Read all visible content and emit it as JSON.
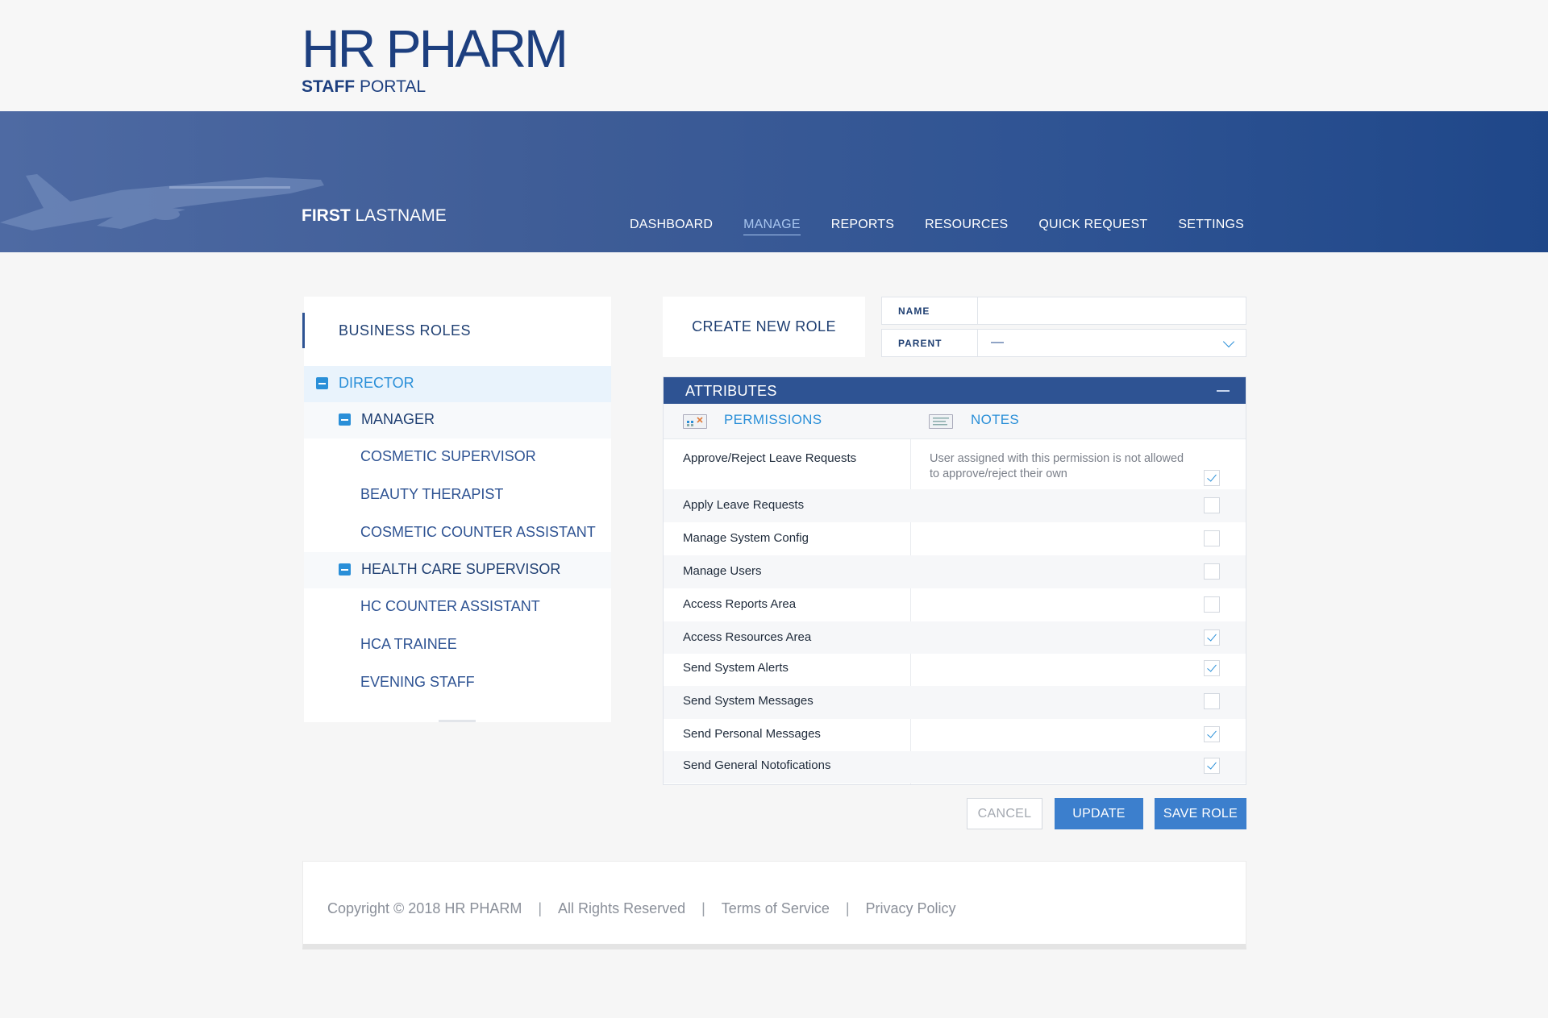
{
  "brand": {
    "logo_main": "HR PHARM",
    "logo_sub_bold": "STAFF",
    "logo_sub": " PORTAL"
  },
  "user": {
    "first": "FIRST",
    "last": " LASTNAME"
  },
  "nav": [
    {
      "label": "DASHBOARD",
      "active": false
    },
    {
      "label": "MANAGE",
      "active": true
    },
    {
      "label": "REPORTS",
      "active": false
    },
    {
      "label": "RESOURCES",
      "active": false
    },
    {
      "label": "QUICK REQUEST",
      "active": false
    },
    {
      "label": "SETTINGS",
      "active": false
    }
  ],
  "sidebar": {
    "title": "BUSINESS ROLES",
    "tree": [
      {
        "label": "DIRECTOR",
        "level": 0,
        "expanded": true
      },
      {
        "label": "MANAGER",
        "level": 1,
        "expanded": true
      },
      {
        "label": "COSMETIC SUPERVISOR",
        "level": 2
      },
      {
        "label": "BEAUTY THERAPIST",
        "level": 2
      },
      {
        "label": "COSMETIC COUNTER ASSISTANT",
        "level": 2
      },
      {
        "label": "HEALTH CARE SUPERVISOR",
        "level": 1,
        "expanded": true
      },
      {
        "label": "HC COUNTER ASSISTANT",
        "level": 2
      },
      {
        "label": "HCA TRAINEE",
        "level": 2
      },
      {
        "label": "EVENING STAFF",
        "level": 2
      }
    ]
  },
  "create_role": {
    "title": "CREATE NEW ROLE"
  },
  "form": {
    "name_label": "NAME",
    "name_value": "",
    "parent_label": "PARENT",
    "parent_value": "—"
  },
  "attributes": {
    "title": "ATTRIBUTES",
    "col_permissions": "PERMISSIONS",
    "col_notes": "NOTES",
    "rows": [
      {
        "name": "Approve/Reject Leave Requests",
        "note": "User assigned with this permission is not allowed to approve/reject their own",
        "checked": true
      },
      {
        "name": "Apply Leave Requests",
        "note": "",
        "checked": false
      },
      {
        "name": "Manage System Config",
        "note": "",
        "checked": false
      },
      {
        "name": "Manage Users",
        "note": "",
        "checked": false
      },
      {
        "name": "Access Reports Area",
        "note": "",
        "checked": false
      },
      {
        "name": "Access Resources Area",
        "note": "",
        "checked": true
      },
      {
        "name": "Send System Alerts",
        "note": "",
        "checked": true
      },
      {
        "name": "Send System Messages",
        "note": "",
        "checked": false
      },
      {
        "name": "Send Personal Messages",
        "note": "",
        "checked": true
      },
      {
        "name": "Send General Notofications",
        "note": "",
        "checked": true
      }
    ]
  },
  "buttons": {
    "cancel": "CANCEL",
    "update": "UPDATE",
    "save": "SAVE ROLE"
  },
  "footer": {
    "copyright": "Copyright © 2018 HR PHARM",
    "rights": "All Rights Reserved",
    "terms": "Terms of Service",
    "privacy": "Privacy Policy",
    "separator": "|"
  }
}
